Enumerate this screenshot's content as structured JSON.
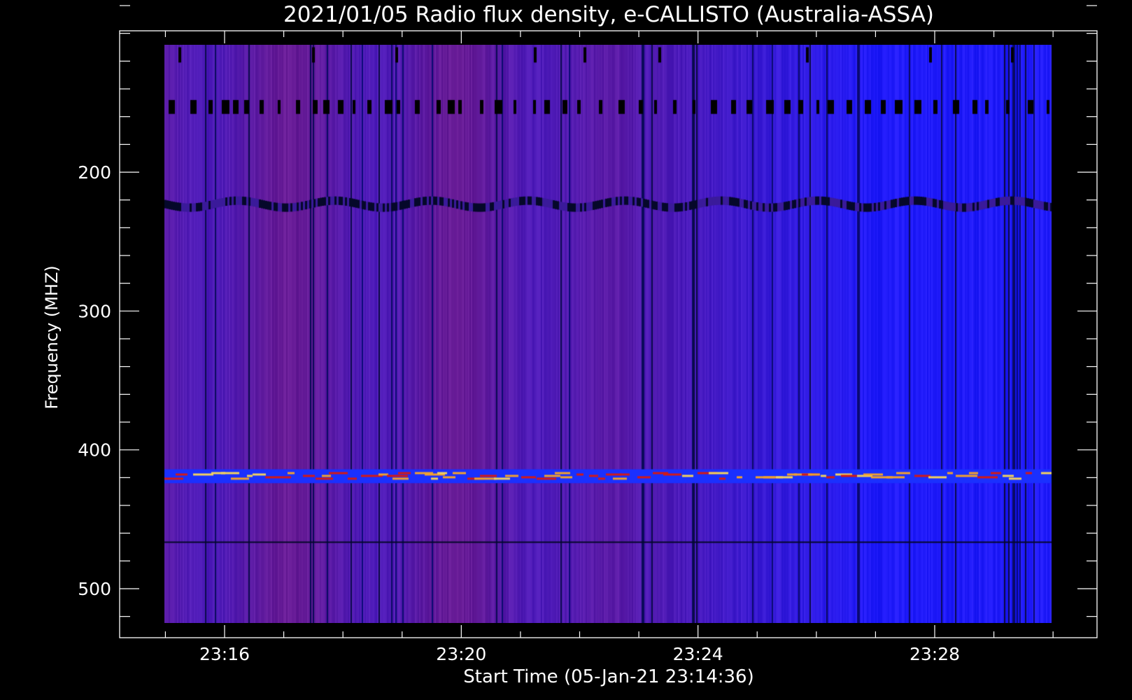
{
  "chart_data": {
    "type": "heatmap",
    "title": "2021/01/05  Radio flux density, e-CALLISTO (Australia-ASSA)",
    "xlabel": "Start Time (05-Jan-21 23:14:36)",
    "ylabel": "Frequency (MHZ)",
    "x_ticks": [
      "23:16",
      "23:20",
      "23:24",
      "23:28"
    ],
    "x_tick_values_min": [
      16,
      20,
      24,
      28
    ],
    "x_range_min": [
      14.6,
      30.0
    ],
    "y_ticks": [
      200,
      300,
      400,
      500
    ],
    "y_range_mhz": [
      45,
      530
    ],
    "y_inverted": true,
    "colors": {
      "background": "#000000",
      "dominant_violet": "#5a1a8c",
      "dominant_blue": "#1a2cf0",
      "strong_red": "#d01a1a",
      "hot_yellow": "#f0d060",
      "dark_lane": "#05082a"
    },
    "features": [
      {
        "kind": "periodic-gaps",
        "freq_mhz": 153
      },
      {
        "kind": "rfi-band",
        "freq_mhz": 223
      },
      {
        "kind": "bright-band",
        "freq_mhz": 419
      },
      {
        "kind": "rfi-band",
        "freq_mhz": 466
      }
    ]
  }
}
